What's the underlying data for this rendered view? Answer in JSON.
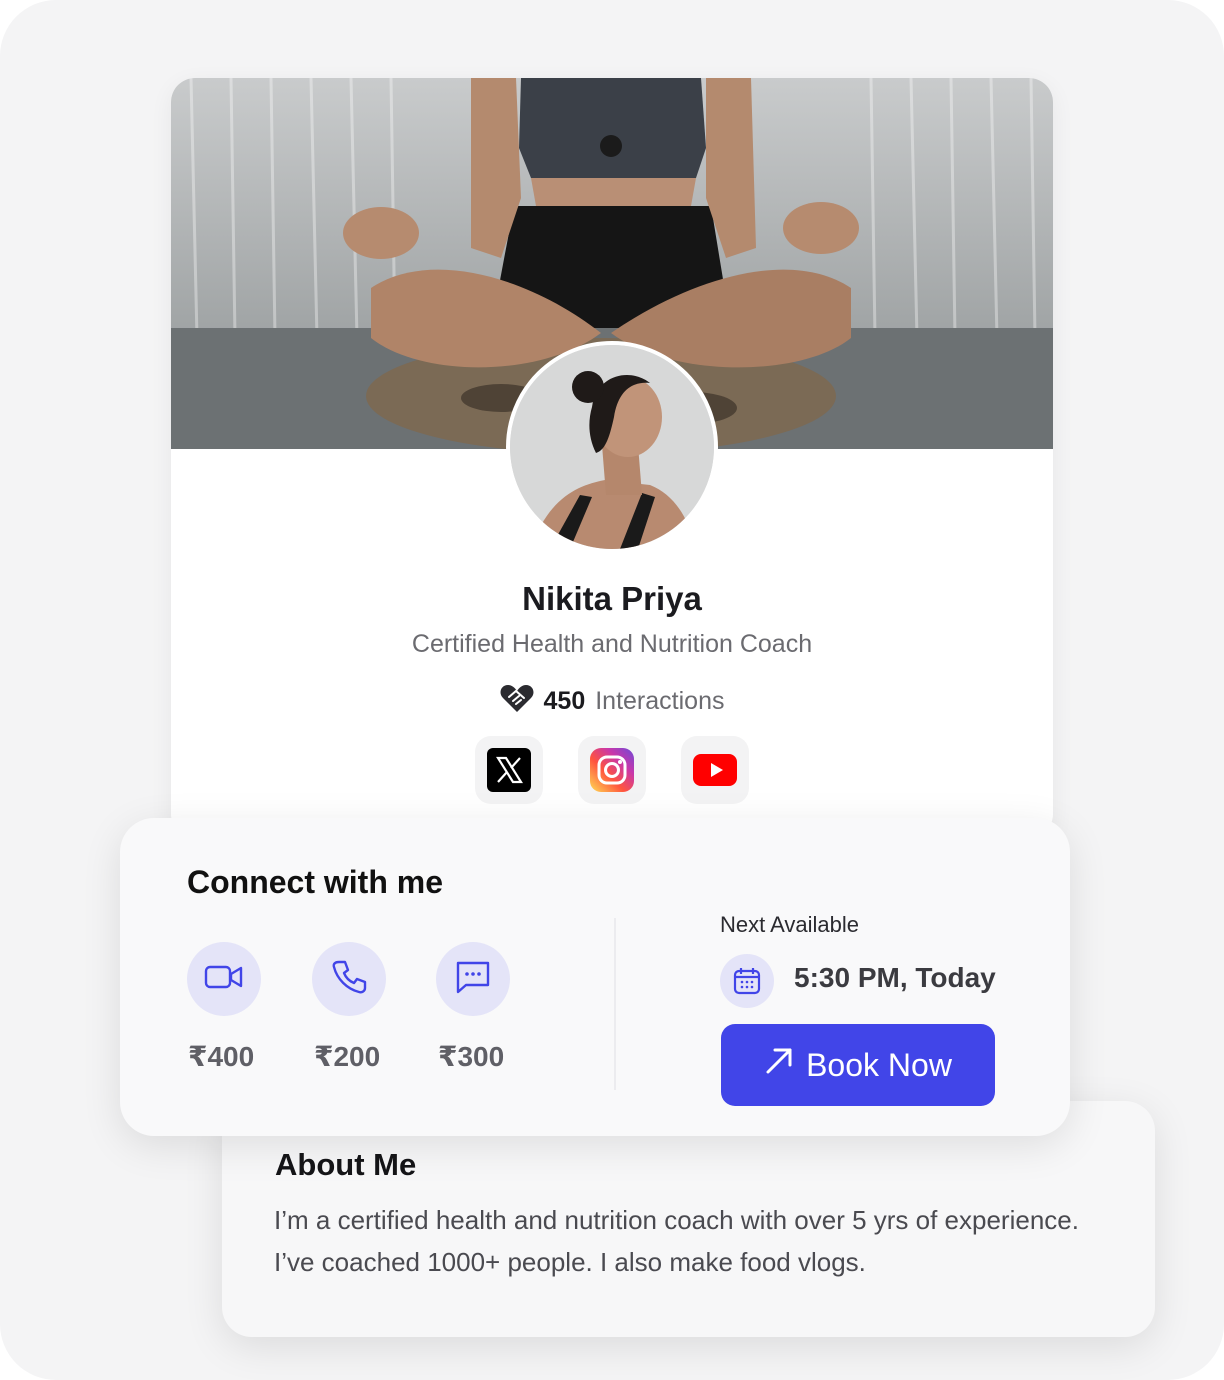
{
  "profile": {
    "name": "Nikita Priya",
    "headline": "Certified Health and Nutrition Coach",
    "interactions_count": "450",
    "interactions_label": "Interactions",
    "socials": [
      {
        "icon": "x-twitter-icon"
      },
      {
        "icon": "instagram-icon"
      },
      {
        "icon": "youtube-icon"
      }
    ]
  },
  "connect": {
    "title": "Connect with me",
    "modes": [
      {
        "icon": "video-call-icon",
        "price": "₹400"
      },
      {
        "icon": "phone-call-icon",
        "price": "₹200"
      },
      {
        "icon": "chat-icon",
        "price": "₹300"
      }
    ],
    "next_available_label": "Next Available",
    "next_available_time": "5:30 PM, Today",
    "book_label": "Book Now"
  },
  "about": {
    "title": "About Me",
    "text": "I’m a certified health and nutrition coach with over 5 yrs of experience. I’ve coached 1000+ people. I also make food vlogs."
  },
  "colors": {
    "accent": "#4145e8",
    "icon_bg": "#e4e4f8",
    "youtube_red": "#ff0000"
  }
}
